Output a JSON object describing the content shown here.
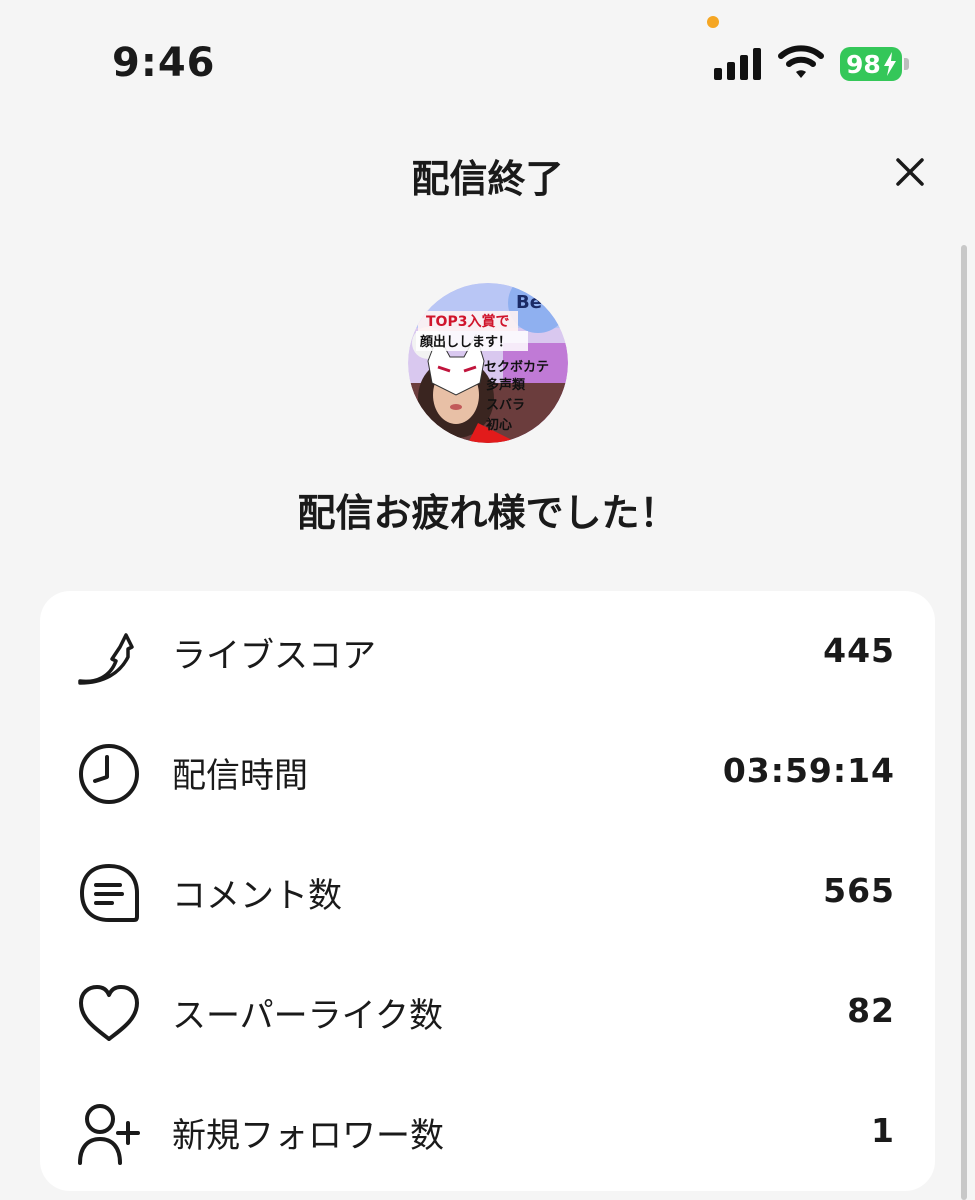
{
  "status_bar": {
    "time": "9:46",
    "battery_level": "98",
    "colors": {
      "battery": "#34c759",
      "privacy_dot": "#f5a623"
    },
    "icons": [
      "signal-icon",
      "wifi-icon",
      "battery-icon",
      "charging-bolt-icon"
    ]
  },
  "header": {
    "title": "配信終了",
    "close_icon": "close-icon"
  },
  "profile": {
    "avatar_text": [
      "TOP3入賞で",
      "顔出しします！",
      "セクボカテ",
      "多声類",
      "スバラ",
      "初心"
    ],
    "avatar_brand": "Be"
  },
  "greeting": "配信お疲れ様でした！",
  "stats": [
    {
      "icon": "live-score-arrow-icon",
      "label": "ライブスコア",
      "value": "445"
    },
    {
      "icon": "clock-icon",
      "label": "配信時間",
      "value": "03:59:14"
    },
    {
      "icon": "comment-bubble-icon",
      "label": "コメント数",
      "value": "565"
    },
    {
      "icon": "heart-icon",
      "label": "スーパーライク数",
      "value": "82"
    },
    {
      "icon": "add-follower-icon",
      "label": "新規フォロワー数",
      "value": "1"
    }
  ]
}
